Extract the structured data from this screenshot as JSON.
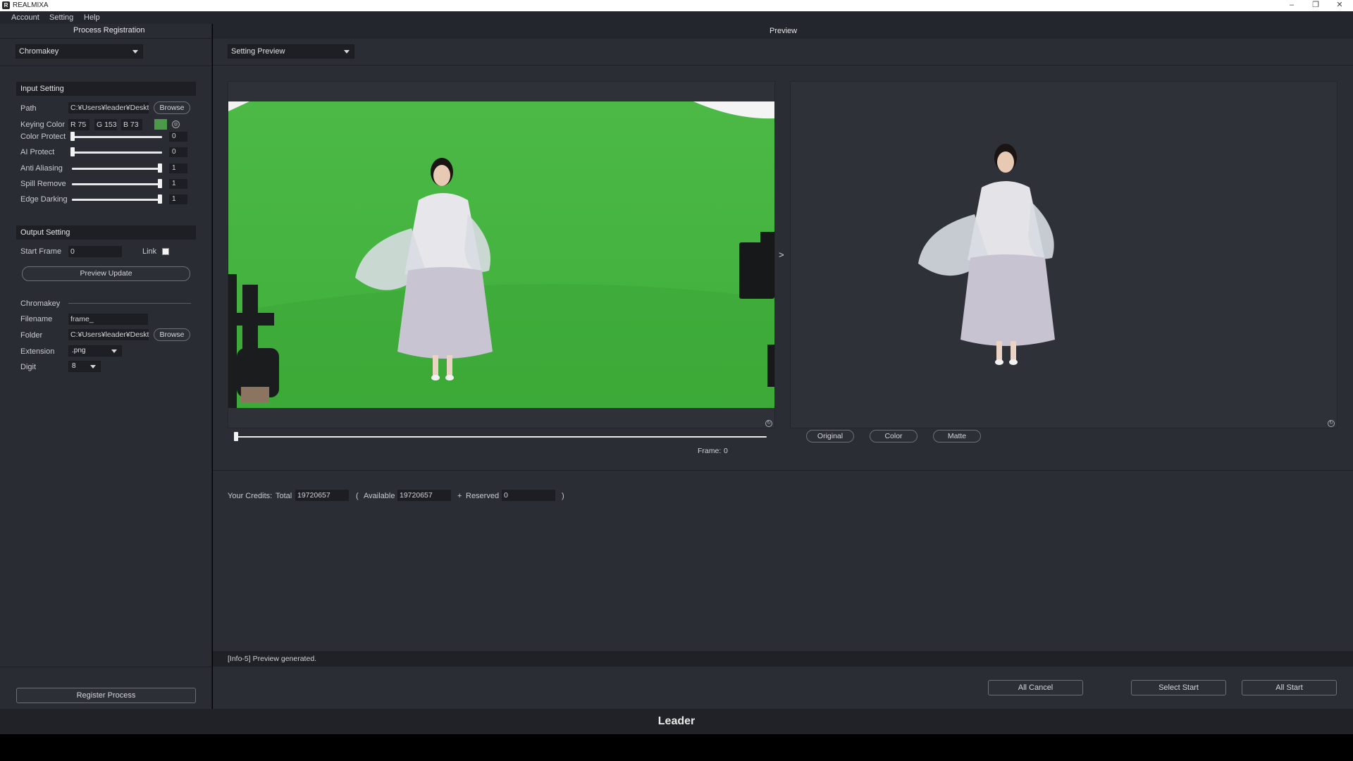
{
  "window": {
    "app_initial": "R",
    "title": "REALMIXA",
    "minimize": "–",
    "restore": "❐",
    "close": "✕"
  },
  "menu": [
    "Account",
    "Setting",
    "Help"
  ],
  "left": {
    "title": "Process Registration",
    "process_type": "Chromakey",
    "input_setting": {
      "heading": "Input Setting",
      "path_label": "Path",
      "path_value": "C:¥Users¥leader¥Desktc",
      "browse": "Browse",
      "keying_label": "Keying Color",
      "r": "R 75",
      "g": "G 153",
      "b": "B 73",
      "keying_color": "#4b9949",
      "sliders": [
        {
          "label": "Color Protect",
          "value": "0",
          "level": 0
        },
        {
          "label": "AI Protect",
          "value": "0",
          "level": 0
        },
        {
          "label": "Anti Aliasing",
          "value": "1",
          "level": 1
        },
        {
          "label": "Spill Remove",
          "value": "1",
          "level": 1
        },
        {
          "label": "Edge Darking",
          "value": "1",
          "level": 1
        }
      ]
    },
    "output_setting": {
      "heading": "Output Setting",
      "start_frame_label": "Start Frame",
      "start_frame_value": "0",
      "link_label": "Link",
      "preview_update": "Preview Update",
      "chromakey_label": "Chromakey",
      "filename_label": "Filename",
      "filename_value": "frame_",
      "folder_label": "Folder",
      "folder_value": "C:¥Users¥leader¥Desktc",
      "browse": "Browse",
      "extension_label": "Extension",
      "extension_value": ".png",
      "digit_label": "Digit",
      "digit_value": "8"
    },
    "register": "Register Process"
  },
  "preview": {
    "title": "Preview",
    "mode": "Setting Preview",
    "arrow": ">",
    "frame_label": "Frame:",
    "frame_value": "0",
    "view_buttons": [
      "Original",
      "Color",
      "Matte"
    ],
    "refresh_glyph": "↻"
  },
  "credits": {
    "label": "Your Credits:",
    "total_label": "Total",
    "total_value": "19720657",
    "open_paren": "(",
    "available_label": "Available",
    "available_value": "19720657",
    "plus": "+",
    "reserved_label": "Reserved",
    "reserved_value": "0",
    "close_paren": ")"
  },
  "status": "[Info-5] Preview generated.",
  "actions": {
    "all_cancel": "All Cancel",
    "select_start": "Select Start",
    "all_start": "All Start"
  },
  "brand": "Leader",
  "colors": {
    "green_screen": "#3fae3a",
    "panel": "#292c33"
  }
}
